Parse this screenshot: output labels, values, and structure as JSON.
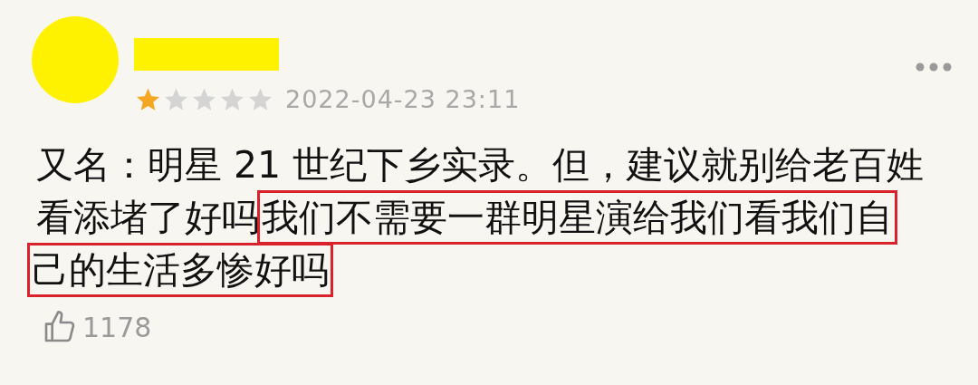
{
  "review": {
    "stars": 1,
    "date": "2022-04-23 23:11",
    "lines": [
      [
        {
          "text": "又名：明星 21 世纪下乡实录。但，建议就别给老百姓",
          "highlighted": false
        }
      ],
      [
        {
          "text": "看添堵了好吗",
          "highlighted": false
        },
        {
          "text": "我们不需要一群明星演给我们看我们自",
          "highlighted": true
        }
      ],
      [
        {
          "text": "己的生活多惨好吗",
          "highlighted": true
        }
      ]
    ],
    "likes": "1178"
  }
}
